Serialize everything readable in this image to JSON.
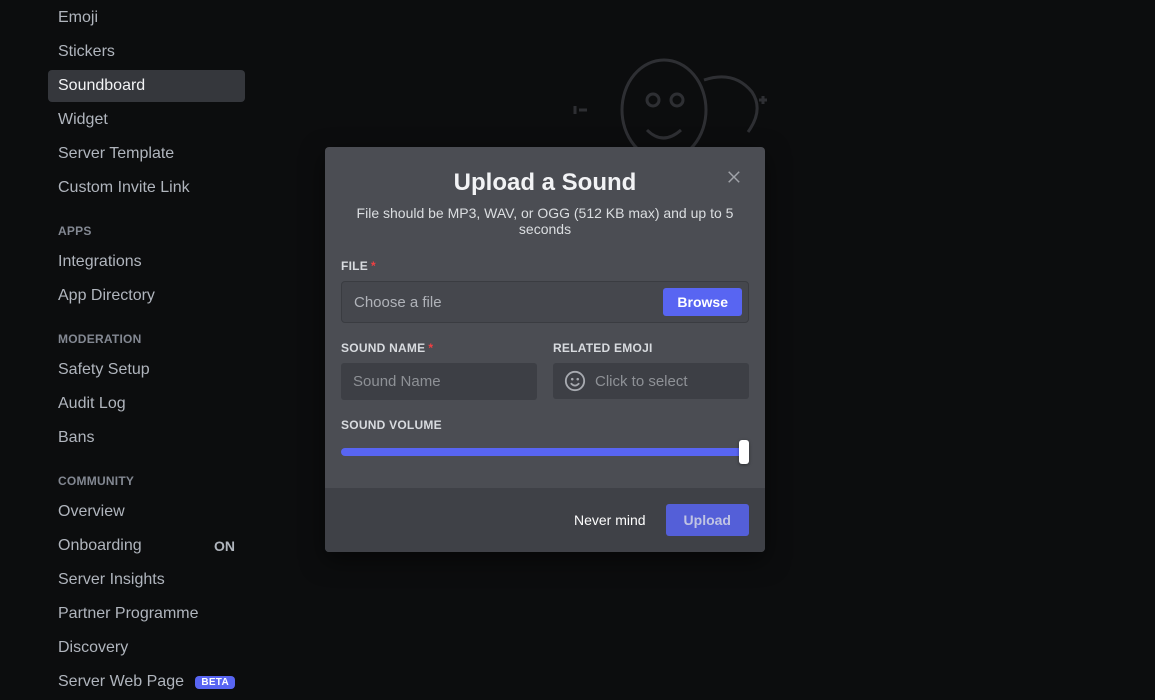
{
  "sidebar": {
    "items": [
      {
        "label": "Emoji",
        "active": false
      },
      {
        "label": "Stickers",
        "active": false
      },
      {
        "label": "Soundboard",
        "active": true
      },
      {
        "label": "Widget",
        "active": false
      },
      {
        "label": "Server Template",
        "active": false
      },
      {
        "label": "Custom Invite Link",
        "active": false
      }
    ],
    "apps_header": "APPS",
    "apps": [
      {
        "label": "Integrations"
      },
      {
        "label": "App Directory"
      }
    ],
    "moderation_header": "MODERATION",
    "moderation": [
      {
        "label": "Safety Setup"
      },
      {
        "label": "Audit Log"
      },
      {
        "label": "Bans"
      }
    ],
    "community_header": "COMMUNITY",
    "community": [
      {
        "label": "Overview"
      },
      {
        "label": "Onboarding",
        "suffix": "ON"
      },
      {
        "label": "Server Insights"
      },
      {
        "label": "Partner Programme"
      },
      {
        "label": "Discovery"
      },
      {
        "label": "Server Web Page",
        "badge": "BETA"
      }
    ]
  },
  "modal": {
    "title": "Upload a Sound",
    "subtitle": "File should be MP3, WAV, or OGG (512 KB max) and up to 5 seconds",
    "file_label": "FILE",
    "file_placeholder": "Choose a file",
    "browse": "Browse",
    "sound_name_label": "SOUND NAME",
    "sound_name_placeholder": "Sound Name",
    "emoji_label": "RELATED EMOJI",
    "emoji_placeholder": "Click to select",
    "volume_label": "SOUND VOLUME",
    "nevermind": "Never mind",
    "upload": "Upload",
    "volume_value": 100
  },
  "colors": {
    "accent": "#5865f2",
    "modal_bg": "#4b4d53",
    "footer_bg": "#3f4147"
  }
}
